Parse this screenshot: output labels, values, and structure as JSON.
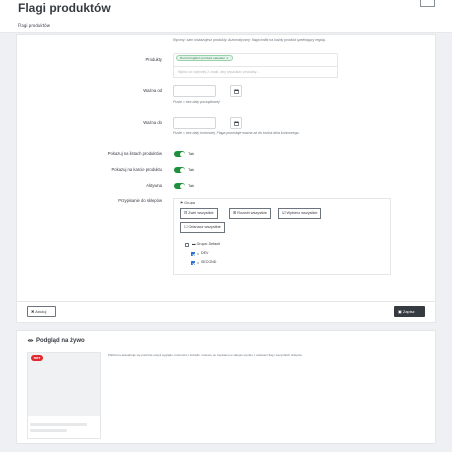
{
  "page": {
    "title": "Flagi produktów"
  },
  "tabs": [
    {
      "label": "Flagi produktów"
    }
  ],
  "form": {
    "mode_help": "Ręczny: sam wskazujesz produkty. Automatyczny: flaga trafia na każdy produkt spełniający regułę.",
    "products": {
      "label": "Produkty",
      "chip": "Hummingbird printed sweater ×",
      "search_placeholder": "Wpisz co najmniej 2 znaki, aby wyszukać produkty..."
    },
    "date_from": {
      "label": "Ważna od",
      "help": "Puste = bez daty początkowej."
    },
    "date_to": {
      "label": "Ważna do",
      "help": "Puste = bez daty końcowej. Flaga pozostaje ważna aż do końca dnia końcowego."
    },
    "toggles": [
      {
        "label": "Pokazuj na listach produktów",
        "value": "Tak",
        "on": true
      },
      {
        "label": "Pokazuj na karcie produktu",
        "value": "Tak",
        "on": true
      },
      {
        "label": "Aktywna",
        "value": "Tak",
        "on": true
      }
    ],
    "shops": {
      "label": "Przypisanie do sklepów",
      "group_label": "Grupa",
      "buttons": {
        "collapse": "Zwiń wszystkie",
        "expand": "Rozwiń wszystkie",
        "select_all": "Wybierz wszystkie",
        "deselect_all": "Odznacz wszystkie"
      },
      "tree": {
        "group": "Grupa: Default",
        "shops": [
          {
            "name": "DEV",
            "checked": true
          },
          {
            "name": "SECOND",
            "checked": true
          }
        ]
      }
    },
    "footer": {
      "cancel": "Anuluj",
      "save": "Zapisz"
    }
  },
  "preview": {
    "title": "Podgląd na żywo",
    "description": "Platforma aktualizuje się podczas edycji wyglądu, koloru/ów i kształtu. Gotowe po zapisaniu w sklepie wyniku z ustawień flag i wszystkich sklepów.",
    "badge": "HOT"
  },
  "colors": {
    "accent": "#25b9d7",
    "toggle_on": "#1e8f3a",
    "badge": "#e0282f",
    "primary_dark": "#363a41"
  }
}
